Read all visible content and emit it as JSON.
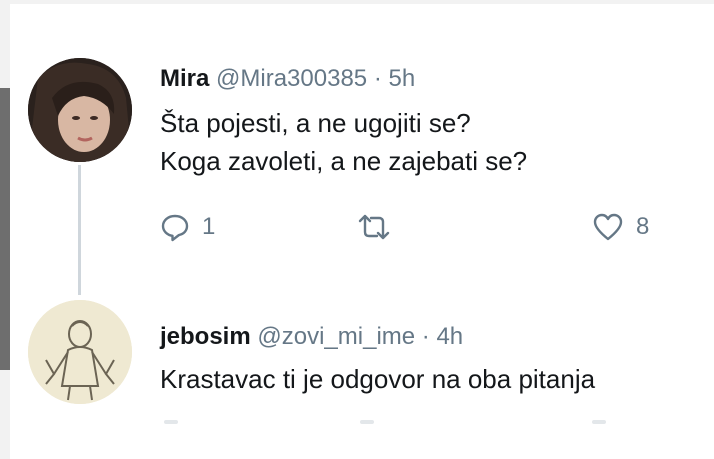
{
  "tweets": [
    {
      "display_name": "Mira",
      "handle": "@Mira300385",
      "separator": "·",
      "time": "5h",
      "lines": [
        "Šta pojesti, a ne ugojiti se?",
        "Koga zavoleti, a ne zajebati se?"
      ],
      "reply_count": "1",
      "like_count": "8"
    },
    {
      "display_name": "jebosim",
      "handle": "@zovi_mi_ime",
      "separator": "·",
      "time": "4h",
      "lines": [
        "Krastavac ti je odgovor na oba pitanja"
      ]
    }
  ],
  "icons": [
    "reply-icon",
    "retweet-icon",
    "heart-icon"
  ],
  "colors": {
    "text": "#14171a",
    "muted": "#657786",
    "thread_line": "#cfd6dc",
    "background": "#ffffff"
  }
}
